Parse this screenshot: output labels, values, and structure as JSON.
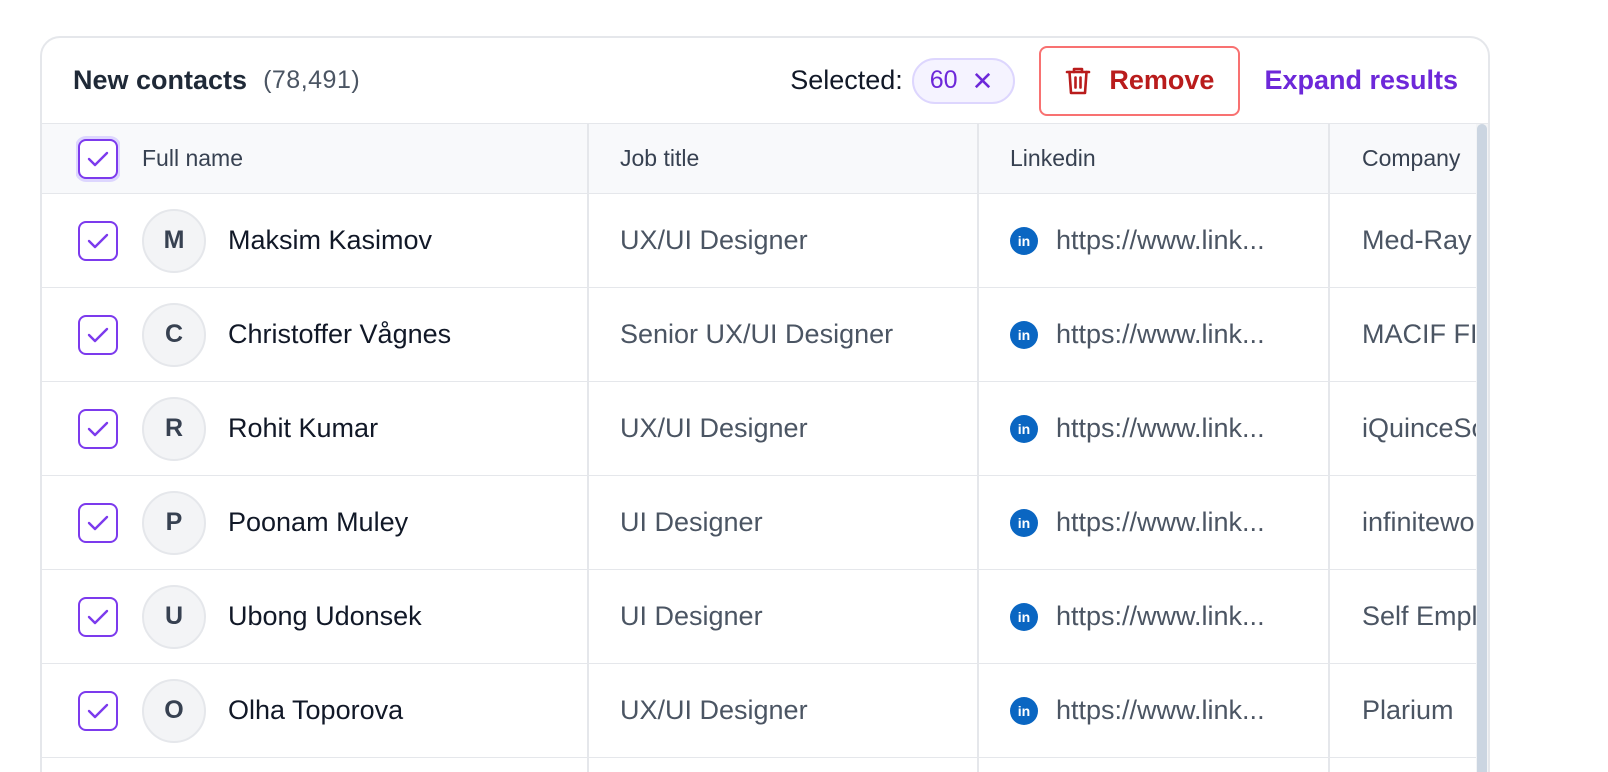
{
  "header": {
    "title": "New contacts",
    "count": "(78,491)",
    "selected_label": "Selected:",
    "selected_count": "60",
    "remove_label": "Remove",
    "expand_label": "Expand results"
  },
  "columns": {
    "full_name": "Full name",
    "job_title": "Job title",
    "linkedin": "Linkedin",
    "company": "Company"
  },
  "rows": [
    {
      "initial": "M",
      "name": "Maksim Kasimov",
      "job": "UX/UI Designer",
      "linkedin": "https://www.link...",
      "company": "Med-Ray",
      "checked": true
    },
    {
      "initial": "C",
      "name": "Christoffer Vågnes",
      "job": "Senior UX/UI Designer",
      "linkedin": "https://www.link...",
      "company": "MACIF FI",
      "checked": true
    },
    {
      "initial": "R",
      "name": "Rohit Kumar",
      "job": "UX/UI Designer",
      "linkedin": "https://www.link...",
      "company": "iQuinceSo",
      "checked": true
    },
    {
      "initial": "P",
      "name": "Poonam Muley",
      "job": "UI Designer",
      "linkedin": "https://www.link...",
      "company": "infinitewo",
      "checked": true
    },
    {
      "initial": "U",
      "name": "Ubong Udonsek",
      "job": "UI Designer",
      "linkedin": "https://www.link...",
      "company": "Self Empl",
      "checked": true
    },
    {
      "initial": "O",
      "name": "Olha Toporova",
      "job": "UX/UI Designer",
      "linkedin": "https://www.link...",
      "company": "Plarium",
      "checked": true
    }
  ],
  "colors": {
    "accent": "#6d28d9",
    "danger": "#b91c1c",
    "linkedin": "#0a66c2"
  },
  "icons": {
    "remove": "trash-icon",
    "clear_selection": "close-icon",
    "linkedin": "linkedin-icon",
    "checkbox": "check-icon"
  }
}
